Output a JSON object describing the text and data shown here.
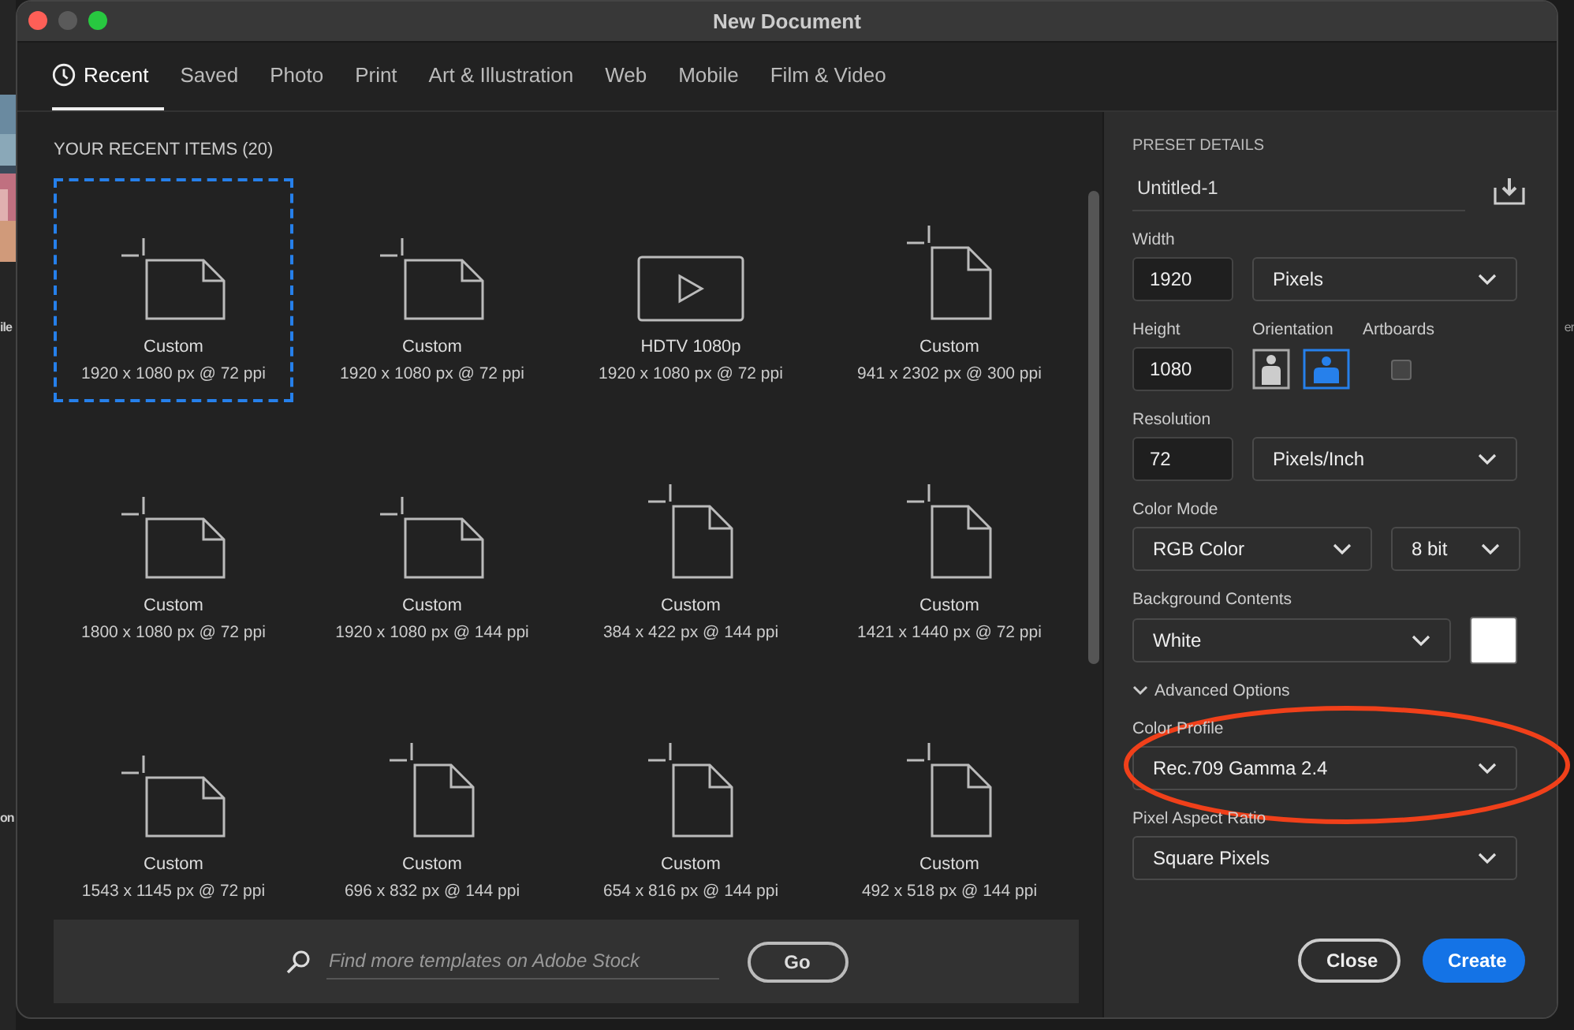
{
  "background_app": {
    "left_texts": [
      "ile",
      "on"
    ],
    "right_texts": [
      "er"
    ]
  },
  "window": {
    "title": "New Document"
  },
  "tabs": [
    {
      "label": "Recent",
      "kind": "clock",
      "selected": true
    },
    {
      "label": "Saved",
      "selected": false
    },
    {
      "label": "Photo",
      "selected": false
    },
    {
      "label": "Print",
      "selected": false
    },
    {
      "label": "Art & Illustration",
      "selected": false
    },
    {
      "label": "Web",
      "selected": false
    },
    {
      "label": "Mobile",
      "selected": false
    },
    {
      "label": "Film & Video",
      "selected": false
    }
  ],
  "recent": {
    "heading": "YOUR RECENT ITEMS",
    "count": "(20)",
    "items": [
      {
        "kind": "landscape",
        "name": "Custom",
        "size": "1920 x 1080 px @ 72 ppi",
        "selected": true
      },
      {
        "kind": "landscape",
        "name": "Custom",
        "size": "1920 x 1080 px @ 72 ppi",
        "selected": false
      },
      {
        "kind": "video",
        "name": "HDTV 1080p",
        "size": "1920 x 1080 px @ 72 ppi",
        "selected": false
      },
      {
        "kind": "portrait",
        "name": "Custom",
        "size": "941 x 2302 px @ 300 ppi",
        "selected": false
      },
      {
        "kind": "landscape",
        "name": "Custom",
        "size": "1800 x 1080 px @ 72 ppi",
        "selected": false
      },
      {
        "kind": "landscape",
        "name": "Custom",
        "size": "1920 x 1080 px @ 144 ppi",
        "selected": false
      },
      {
        "kind": "portrait",
        "name": "Custom",
        "size": "384 x 422 px @ 144 ppi",
        "selected": false
      },
      {
        "kind": "portrait",
        "name": "Custom",
        "size": "1421 x 1440 px @ 72 ppi",
        "selected": false
      },
      {
        "kind": "landscape",
        "name": "Custom",
        "size": "1543 x 1145 px @ 72 ppi",
        "selected": false
      },
      {
        "kind": "portrait",
        "name": "Custom",
        "size": "696 x 832 px @ 144 ppi",
        "selected": false
      },
      {
        "kind": "portrait",
        "name": "Custom",
        "size": "654 x 816 px @ 144 ppi",
        "selected": false
      },
      {
        "kind": "portrait",
        "name": "Custom",
        "size": "492 x 518 px @ 144 ppi",
        "selected": false
      }
    ]
  },
  "search": {
    "placeholder": "Find more templates on Adobe Stock",
    "button": "Go"
  },
  "preset": {
    "heading": "PRESET DETAILS",
    "name": "Untitled-1",
    "width": {
      "label": "Width",
      "value": "1920",
      "unit": "Pixels"
    },
    "height": {
      "label": "Height",
      "value": "1080"
    },
    "orientation": {
      "label": "Orientation",
      "options": [
        {
          "kind": "portrait",
          "selected": false
        },
        {
          "kind": "landscape",
          "selected": true
        }
      ]
    },
    "artboards": {
      "label": "Artboards",
      "checked": false
    },
    "resolution": {
      "label": "Resolution",
      "value": "72",
      "unit": "Pixels/Inch"
    },
    "color_mode": {
      "label": "Color Mode",
      "value": "RGB Color",
      "depth": "8 bit"
    },
    "background": {
      "label": "Background Contents",
      "value": "White",
      "color": "#ffffff"
    },
    "advanced": {
      "label": "Advanced Options",
      "expanded": true
    },
    "color_profile": {
      "label": "Color Profile",
      "value": "Rec.709 Gamma 2.4"
    },
    "pixel_aspect": {
      "label": "Pixel Aspect Ratio",
      "value": "Square Pixels"
    }
  },
  "buttons": [
    {
      "label": "Close",
      "kind": "secondary"
    },
    {
      "label": "Create",
      "kind": "primary"
    }
  ]
}
